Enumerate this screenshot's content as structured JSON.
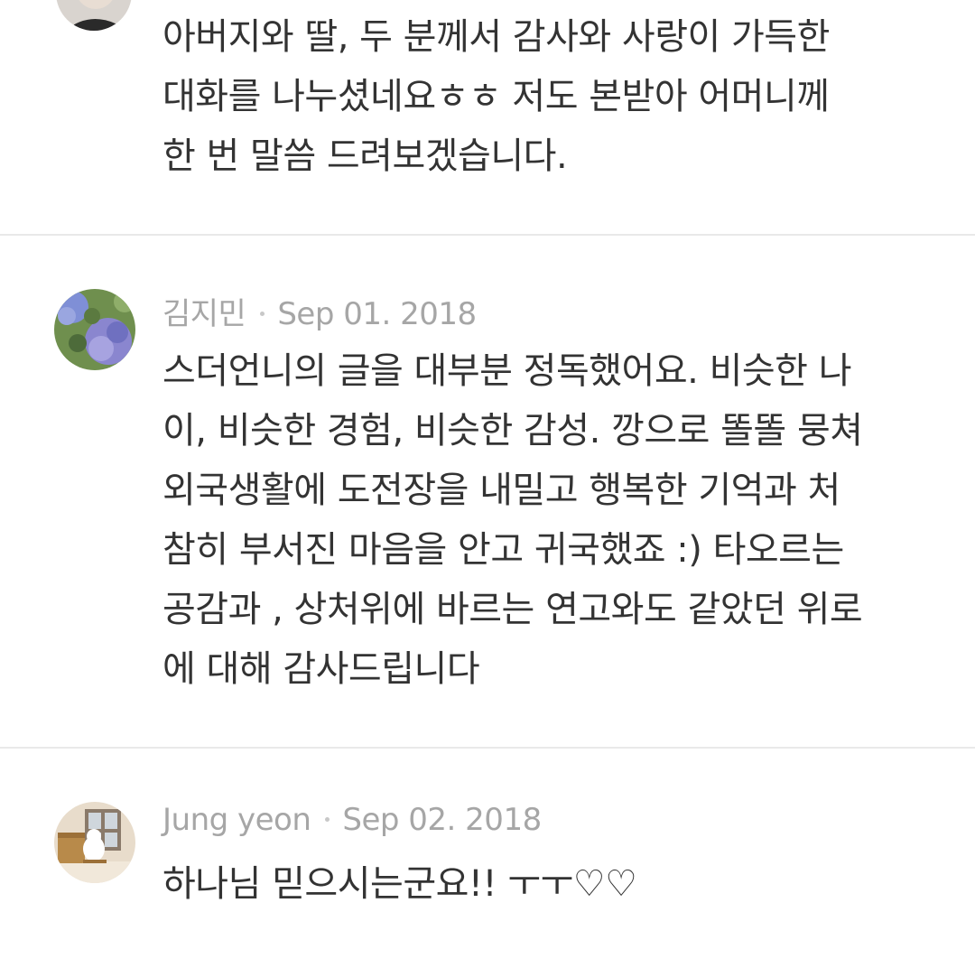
{
  "comments": [
    {
      "author": "",
      "date": "",
      "text": "아버지와 딸, 두 분께서 감사와 사랑이 가득한\n대화를 나누셨네요ㅎㅎ 저도 본받아 어머니께\n한 번 말씀 드려보겠습니다.",
      "avatar_icon": "person-avatar-icon"
    },
    {
      "author": "김지민",
      "date": "Sep 01. 2018",
      "text": "스더언니의 글을 대부분 정독했어요. 비슷한 나\n이, 비슷한 경험, 비슷한 감성. 깡으로 똘똘 뭉쳐\n외국생활에 도전장을 내밀고 행복한 기억과 처\n참히 부서진 마음을 안고 귀국했죠 :) 타오르는\n공감과 , 상처위에 바르는 연고와도 같았던 위로\n에 대해 감사드립니다",
      "avatar_icon": "hydrangea-avatar-icon"
    },
    {
      "author": "Jung yeon",
      "date": "Sep 02. 2018",
      "text": "하나님 믿으시는군요!!  ㅜㅜ♡♡",
      "avatar_icon": "bear-piano-avatar-icon"
    }
  ],
  "colors": {
    "text": "#333333",
    "meta": "#a6a6a6",
    "divider": "#e9e9e9",
    "background": "#ffffff"
  }
}
